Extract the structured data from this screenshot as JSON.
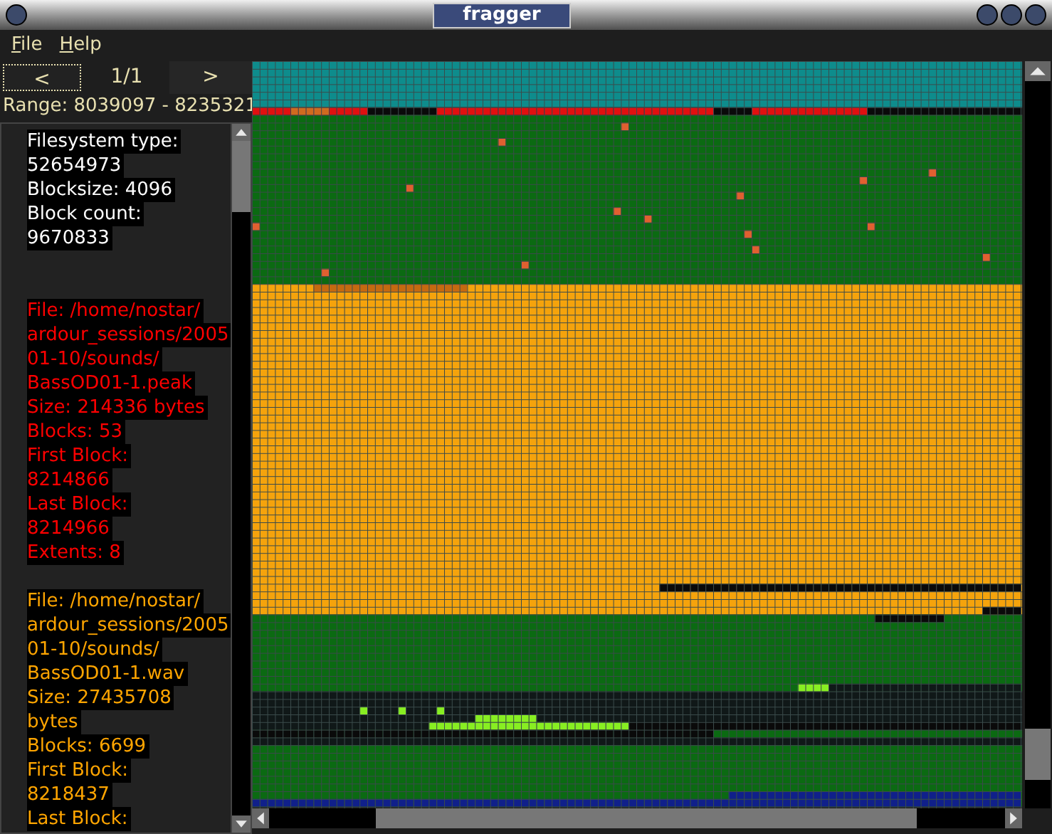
{
  "window": {
    "title": "fragger"
  },
  "menu": [
    {
      "label": "File"
    },
    {
      "label": "Help"
    }
  ],
  "nav": {
    "prev": "<",
    "page": "1/1",
    "next": ">"
  },
  "range": "Range: 8039097 - 8235321",
  "info_blocks": [
    {
      "kind": "filesystem",
      "lines": [
        "Filesystem type:",
        "52654973",
        "Blocksize: 4096",
        "Block count:",
        "9670833"
      ]
    },
    {
      "kind": "file",
      "lines": [
        "File: /home/nostar/",
        "ardour_sessions/2005",
        "01-10/sounds/",
        "BassOD01-1.peak",
        "Size: 214336 bytes",
        "Blocks: 53",
        "First Block:",
        "8214866",
        "Last Block:",
        "8214966",
        "Extents: 8"
      ]
    },
    {
      "kind": "file",
      "lines": [
        "File: /home/nostar/",
        "ardour_sessions/2005",
        "01-10/sounds/",
        "BassOD01-1.wav",
        "Size: 27435708",
        "bytes",
        "Blocks: 6699",
        "First Block:",
        "8218437",
        "Last Block:"
      ]
    }
  ]
}
